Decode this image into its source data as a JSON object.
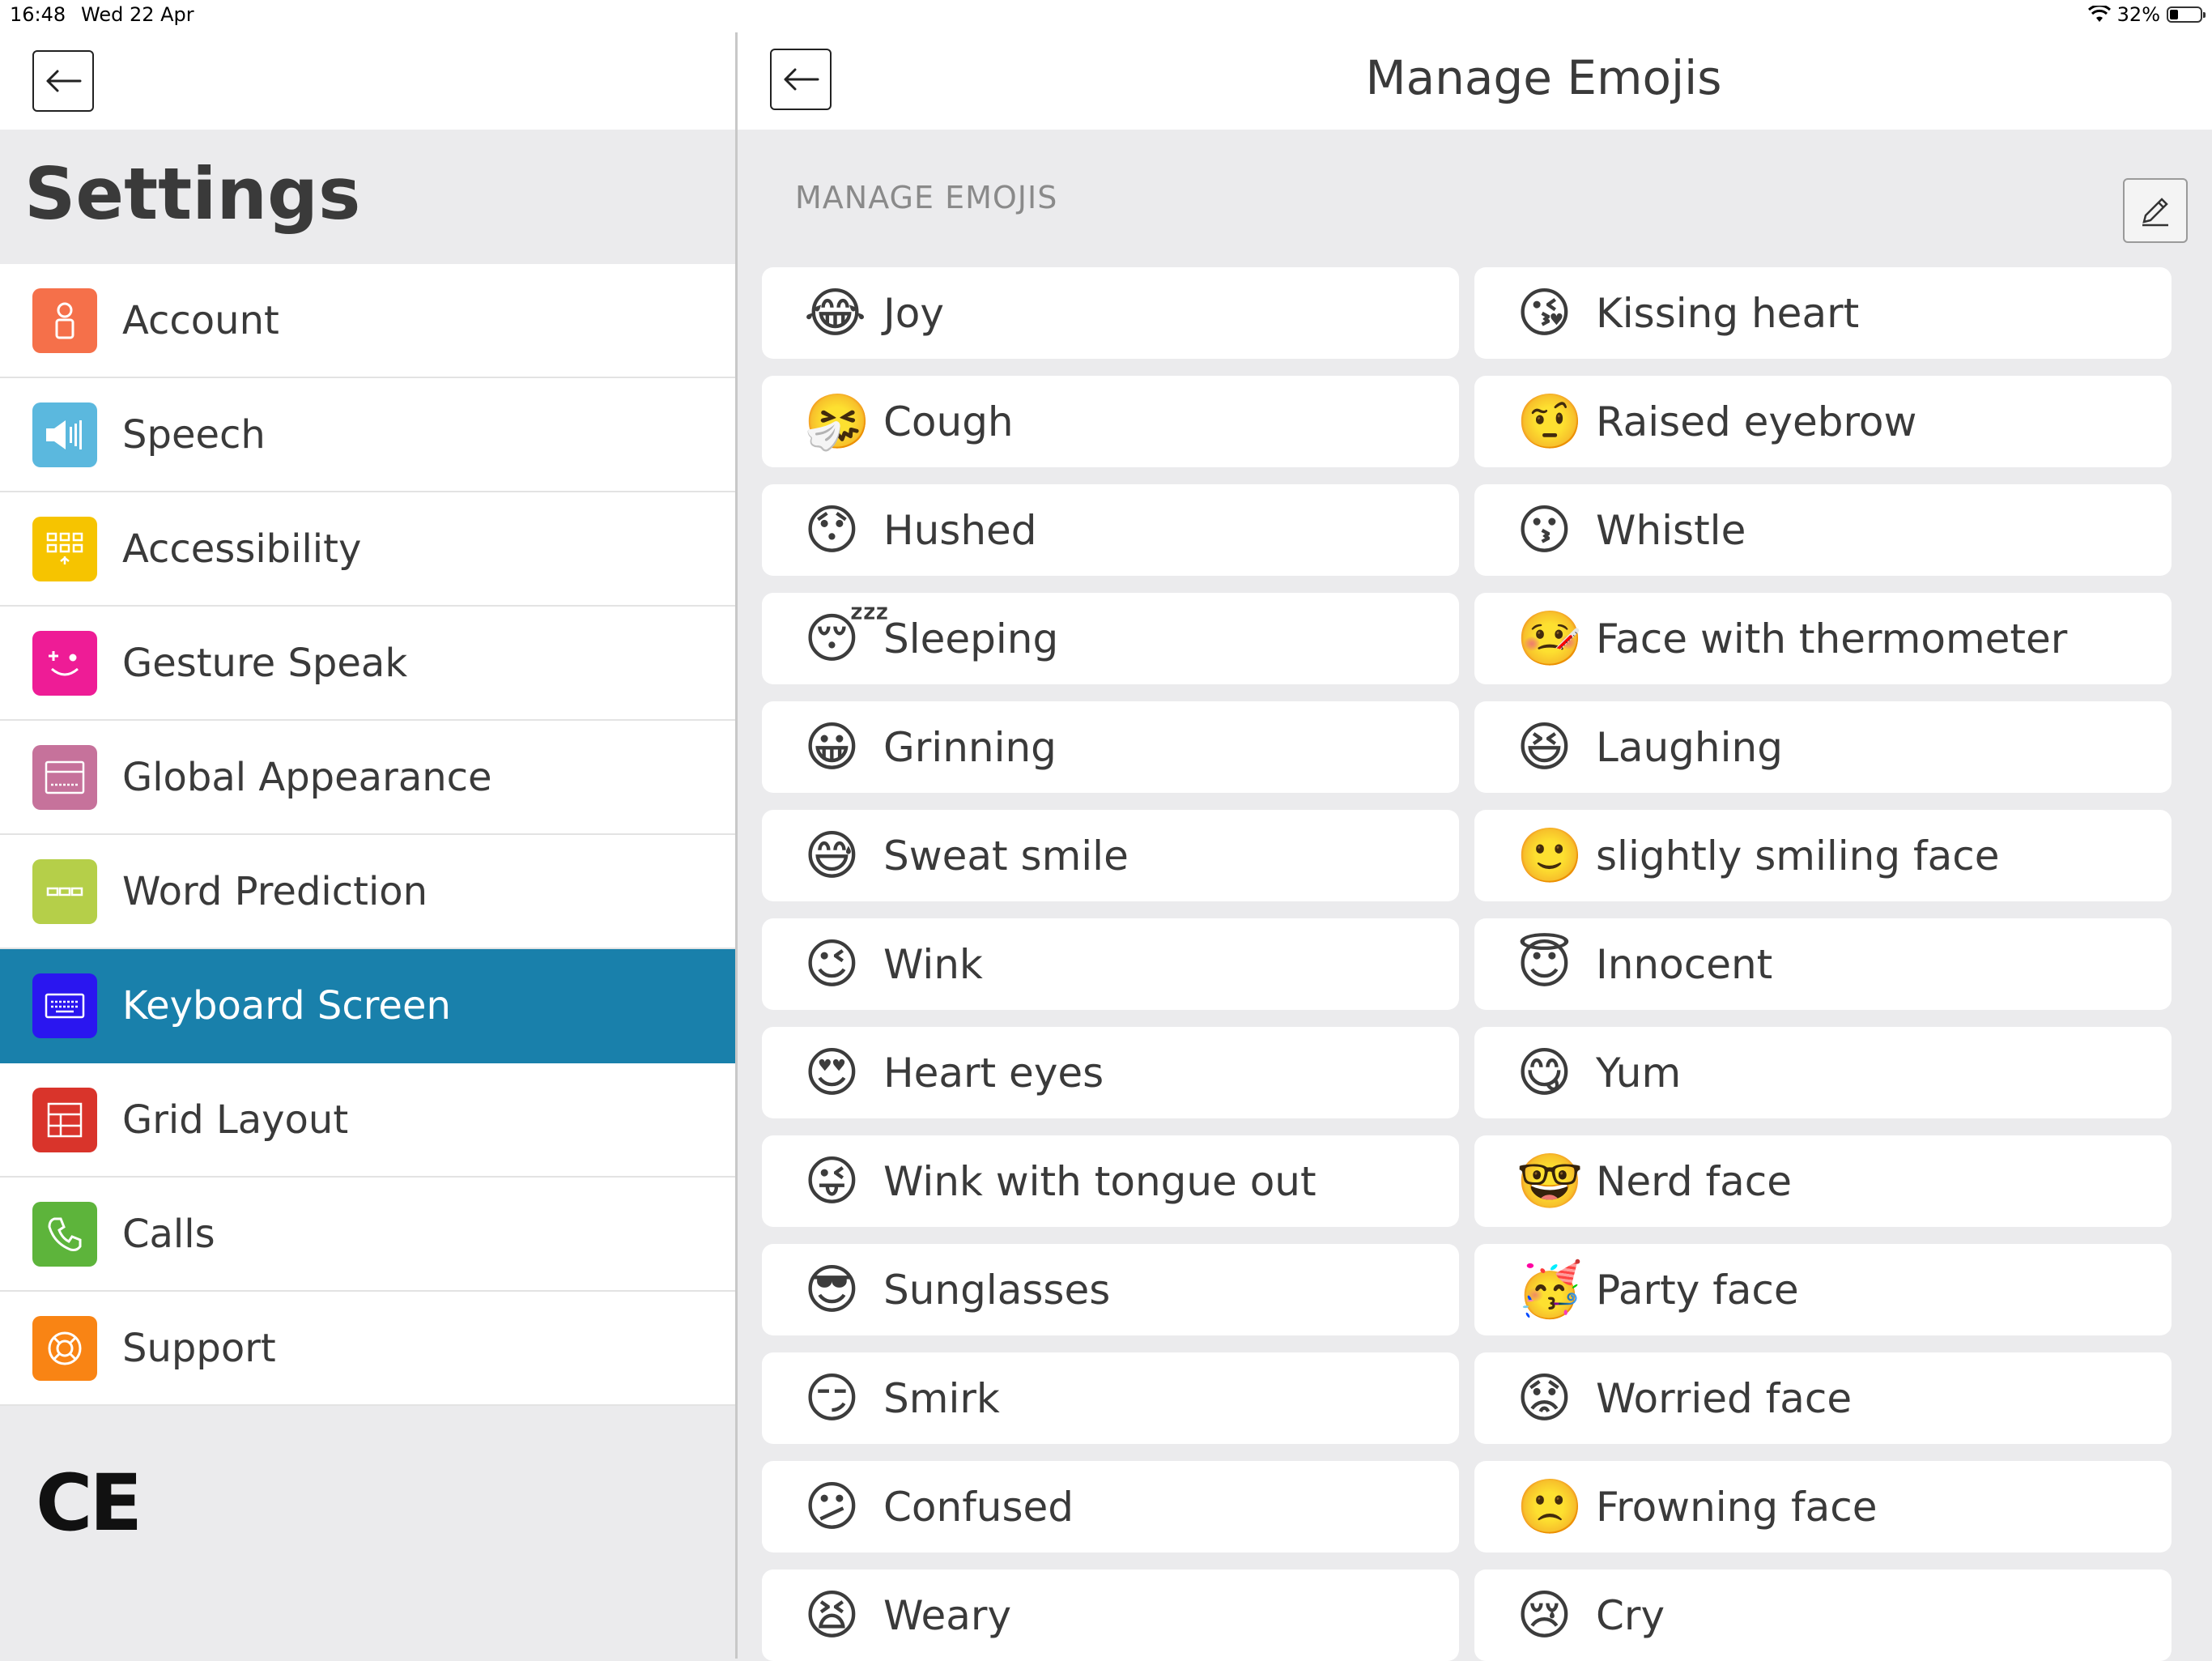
{
  "status_bar": {
    "time": "16:48",
    "date": "Wed 22 Apr",
    "battery": "32%",
    "battery_level": 0.32
  },
  "left_pane": {
    "title": "Settings",
    "back_icon": "arrow-left-icon",
    "menu": [
      {
        "label": "Account",
        "icon": "account-icon",
        "color": "#f5704a"
      },
      {
        "label": "Speech",
        "icon": "speaker-icon",
        "color": "#5bb8de"
      },
      {
        "label": "Accessibility",
        "icon": "accessibility-grid-icon",
        "color": "#f6c400"
      },
      {
        "label": "Gesture Speak",
        "icon": "gesture-face-icon",
        "color": "#ee1c96"
      },
      {
        "label": "Global Appearance",
        "icon": "appearance-icon",
        "color": "#c6729b"
      },
      {
        "label": "Word Prediction",
        "icon": "word-prediction-icon",
        "color": "#b5cf49"
      },
      {
        "label": "Keyboard Screen",
        "icon": "keyboard-icon",
        "color": "#2a16f0",
        "active": true
      },
      {
        "label": "Grid Layout",
        "icon": "grid-layout-icon",
        "color": "#d9342b"
      },
      {
        "label": "Calls",
        "icon": "phone-icon",
        "color": "#5db43b"
      },
      {
        "label": "Support",
        "icon": "lifebuoy-icon",
        "color": "#f98414"
      }
    ],
    "ce_mark": "CE"
  },
  "right_pane": {
    "title": "Manage Emojis",
    "section_label": "MANAGE EMOJIS",
    "edit_icon": "pencil-icon",
    "emojis_left": [
      {
        "emoji": "😂",
        "label": "Joy"
      },
      {
        "emoji": "🤧",
        "label": "Cough"
      },
      {
        "emoji": "😯",
        "label": "Hushed"
      },
      {
        "emoji": "😴",
        "label": "Sleeping"
      },
      {
        "emoji": "😀",
        "label": "Grinning"
      },
      {
        "emoji": "😅",
        "label": "Sweat smile"
      },
      {
        "emoji": "😉",
        "label": "Wink"
      },
      {
        "emoji": "😍",
        "label": "Heart eyes"
      },
      {
        "emoji": "😜",
        "label": "Wink with tongue out"
      },
      {
        "emoji": "😎",
        "label": "Sunglasses"
      },
      {
        "emoji": "😏",
        "label": "Smirk"
      },
      {
        "emoji": "😕",
        "label": "Confused"
      },
      {
        "emoji": "😫",
        "label": "Weary"
      }
    ],
    "emojis_right": [
      {
        "emoji": "😘",
        "label": "Kissing heart"
      },
      {
        "emoji": "🤨",
        "label": "Raised eyebrow"
      },
      {
        "emoji": "😗",
        "label": "Whistle"
      },
      {
        "emoji": "🤒",
        "label": "Face with thermometer"
      },
      {
        "emoji": "😆",
        "label": "Laughing"
      },
      {
        "emoji": "🙂",
        "label": "slightly smiling face"
      },
      {
        "emoji": "😇",
        "label": "Innocent"
      },
      {
        "emoji": "😋",
        "label": "Yum"
      },
      {
        "emoji": "🤓",
        "label": "Nerd face"
      },
      {
        "emoji": "🥳",
        "label": "Party face"
      },
      {
        "emoji": "😟",
        "label": "Worried face"
      },
      {
        "emoji": "🙁",
        "label": "Frowning face"
      },
      {
        "emoji": "😢",
        "label": "Cry"
      }
    ]
  }
}
